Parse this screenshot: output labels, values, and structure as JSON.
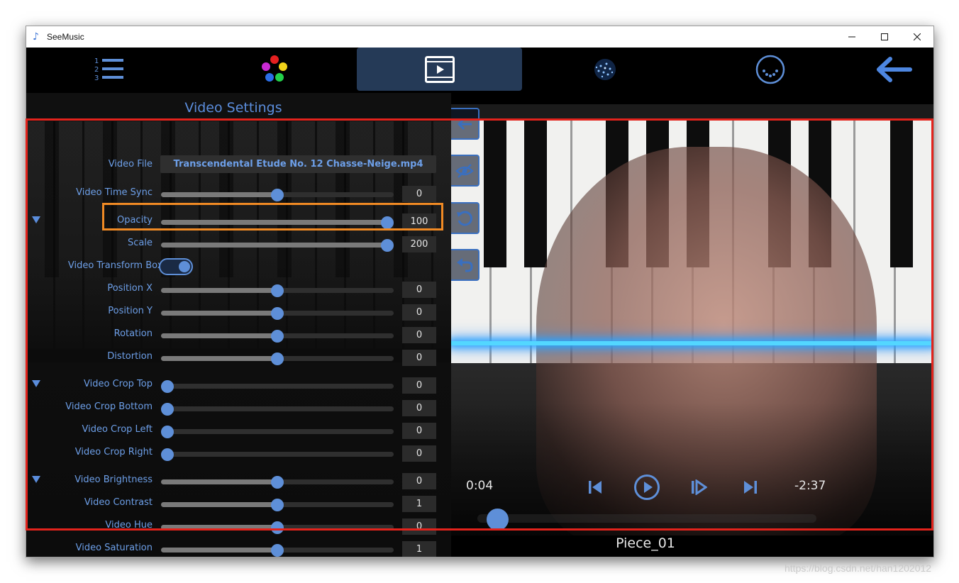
{
  "window": {
    "title": "SeeMusic"
  },
  "nav": {
    "items": [
      {
        "name": "playlist"
      },
      {
        "name": "colors"
      },
      {
        "name": "video",
        "active": true
      },
      {
        "name": "particles"
      },
      {
        "name": "circle-menu"
      },
      {
        "name": "back"
      }
    ]
  },
  "settings": {
    "title": "Video Settings",
    "file": {
      "label": "Video File",
      "value": "Transcendental Etude No. 12 Chasse-Neige.mp4"
    },
    "sync": {
      "label": "Video Time Sync",
      "value": "0",
      "level": 0.5
    },
    "opacity": {
      "label": "Opacity",
      "value": "100",
      "level": 1.0
    },
    "scale": {
      "label": "Scale",
      "value": "200",
      "level": 1.0
    },
    "transform_box": {
      "label": "Video Transform Box On",
      "on": true
    },
    "position_x": {
      "label": "Position X",
      "value": "0",
      "level": 0.5
    },
    "position_y": {
      "label": "Position Y",
      "value": "0",
      "level": 0.5
    },
    "rotation": {
      "label": "Rotation",
      "value": "0",
      "level": 0.5
    },
    "distortion": {
      "label": "Distortion",
      "value": "0",
      "level": 0.5
    },
    "crop_top": {
      "label": "Video Crop Top",
      "value": "0",
      "level": 0.0
    },
    "crop_bottom": {
      "label": "Video Crop Bottom",
      "value": "0",
      "level": 0.0
    },
    "crop_left": {
      "label": "Video Crop Left",
      "value": "0",
      "level": 0.0
    },
    "crop_right": {
      "label": "Video Crop Right",
      "value": "0",
      "level": 0.0
    },
    "brightness": {
      "label": "Video Brightness",
      "value": "0",
      "level": 0.5
    },
    "contrast": {
      "label": "Video Contrast",
      "value": "1",
      "level": 0.5
    },
    "hue": {
      "label": "Video Hue",
      "value": "0",
      "level": 0.5
    },
    "saturation": {
      "label": "Video Saturation",
      "value": "1",
      "level": 0.5
    }
  },
  "player": {
    "current_time": "0:04",
    "remaining_time": "-2:37",
    "progress": 0.03,
    "piece_name": "Piece_01"
  },
  "watermark": "https://blog.csdn.net/han1202012",
  "colors": {
    "accent": "#5e8fd8",
    "label": "#6d9fe8",
    "highlight_red": "#e3231c",
    "highlight_orange": "#f08a24"
  }
}
